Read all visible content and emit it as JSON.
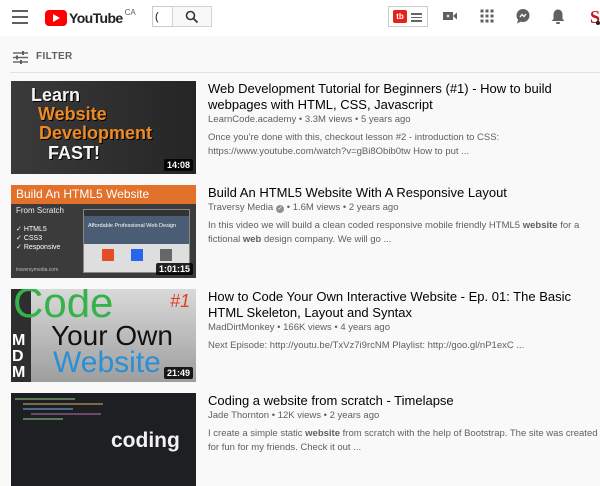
{
  "header": {
    "logo_text": "YouTube",
    "logo_region": "CA",
    "search_value": "(",
    "extension_badge": "tb",
    "cut_avatar_text": "S"
  },
  "filter": {
    "label": "FILTER"
  },
  "results": [
    {
      "title": "Web Development Tutorial for Beginners (#1) - How to build webpages with HTML, CSS, Javascript",
      "channel": "LearnCode.academy",
      "views": "3.3M views",
      "age": "5 years ago",
      "description_line1": "Once you're done with this, checkout lesson #2 - introduction to CSS:",
      "description_line2": "https://www.youtube.com/watch?v=gBi8Obib0tw How to put ...",
      "duration": "14:08",
      "thumb_lines": [
        "Learn",
        "Website",
        "Development",
        "FAST!"
      ]
    },
    {
      "title": "Build An HTML5 Website With A Responsive Layout",
      "channel": "Traversy Media",
      "verified_mark": "✓",
      "views": "1.6M views",
      "age": "2 years ago",
      "description_line1_a": "In this video we will build a clean coded responsive mobile friendly HTML5 ",
      "description_line1_b": "website",
      "description_line1_c": " for a",
      "description_line2_a": "fictional ",
      "description_line2_b": "web",
      "description_line2_c": " design company. We will go ...",
      "duration": "1:01:15",
      "thumb_header": "Build An HTML5 Website",
      "thumb_sub": "From Scratch",
      "thumb_checks": [
        "HTML5",
        "CSS3",
        "Responsive"
      ],
      "thumb_site": "Affordable Professional Web Design",
      "thumb_url": "traversymedia.com"
    },
    {
      "title": "How to Code Your Own Interactive Website - Ep. 01: The Basic HTML Skeleton, Layout and Syntax",
      "channel": "MadDirtMonkey",
      "views": "166K views",
      "age": "4 years ago",
      "description_line1": "Next Episode: http://youtu.be/TxVz7i9rcNM Playlist: http://goo.gl/nP1exC ...",
      "duration": "21:49",
      "thumb_lines": [
        "Code",
        "Your Own",
        "Website"
      ],
      "thumb_badge": "#1",
      "thumb_mdm": [
        "M",
        "D",
        "M"
      ]
    },
    {
      "title": "Coding a website from scratch - Timelapse",
      "channel": "Jade Thornton",
      "views": "12K views",
      "age": "2 years ago",
      "description_line1_a": "I create a simple static ",
      "description_line1_b": "website",
      "description_line1_c": " from scratch with the help of Bootstrap. The site was created",
      "description_line2": "for fun for my friends. Check it out ...",
      "thumb_word": "coding"
    }
  ],
  "colors": {
    "brand_red": "#ff0000",
    "meta_gray": "#606060",
    "icon_gray": "#606060"
  },
  "icons": [
    "menu-icon",
    "search-icon",
    "video-camera-icon",
    "apps-grid-icon",
    "chat-icon",
    "notifications-bell-icon",
    "filter-sliders-icon"
  ]
}
